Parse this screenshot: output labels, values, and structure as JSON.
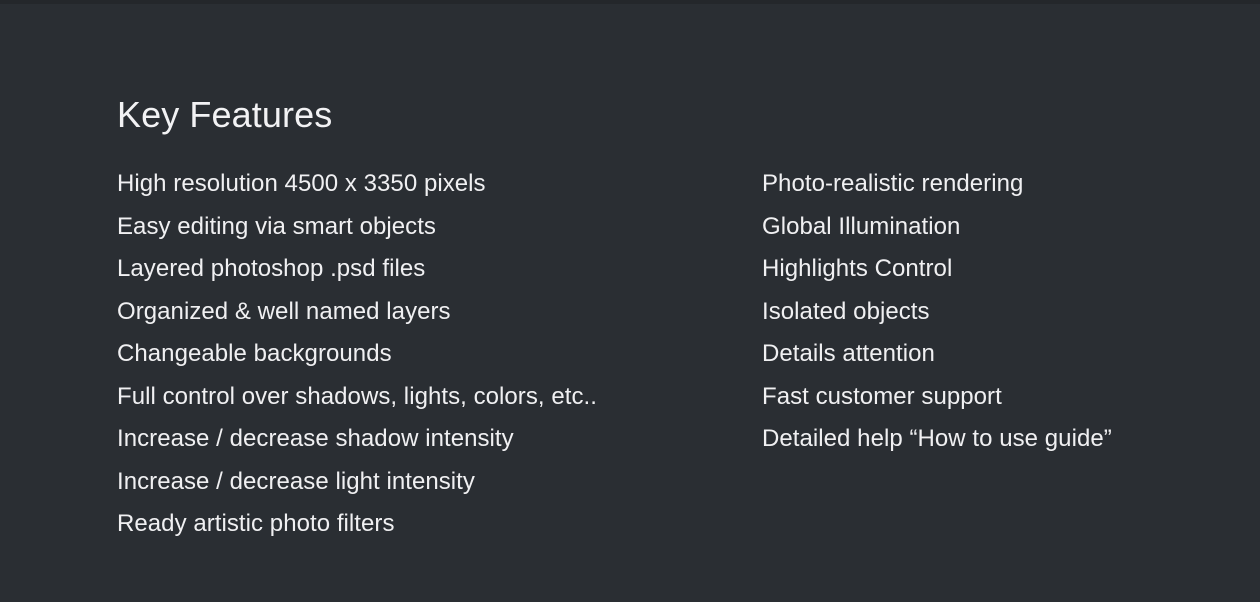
{
  "slide": {
    "title": "Key Features",
    "background_color": "#2a2e33",
    "top_edge_color": "#24272b",
    "text_color": "#f0f0f2"
  },
  "columns": {
    "left": {
      "items": [
        "High resolution 4500 x 3350 pixels",
        "Easy editing via smart objects",
        "Layered photoshop .psd files",
        "Organized & well named layers",
        "Changeable backgrounds",
        "Full control over shadows, lights, colors, etc..",
        "Increase / decrease shadow intensity",
        "Increase / decrease light intensity",
        "Ready artistic photo filters"
      ]
    },
    "right": {
      "items": [
        "Photo-realistic rendering",
        "Global Illumination",
        "Highlights Control",
        "Isolated objects",
        "Details attention",
        "Fast customer support",
        "Detailed help “How to use guide”"
      ]
    }
  }
}
